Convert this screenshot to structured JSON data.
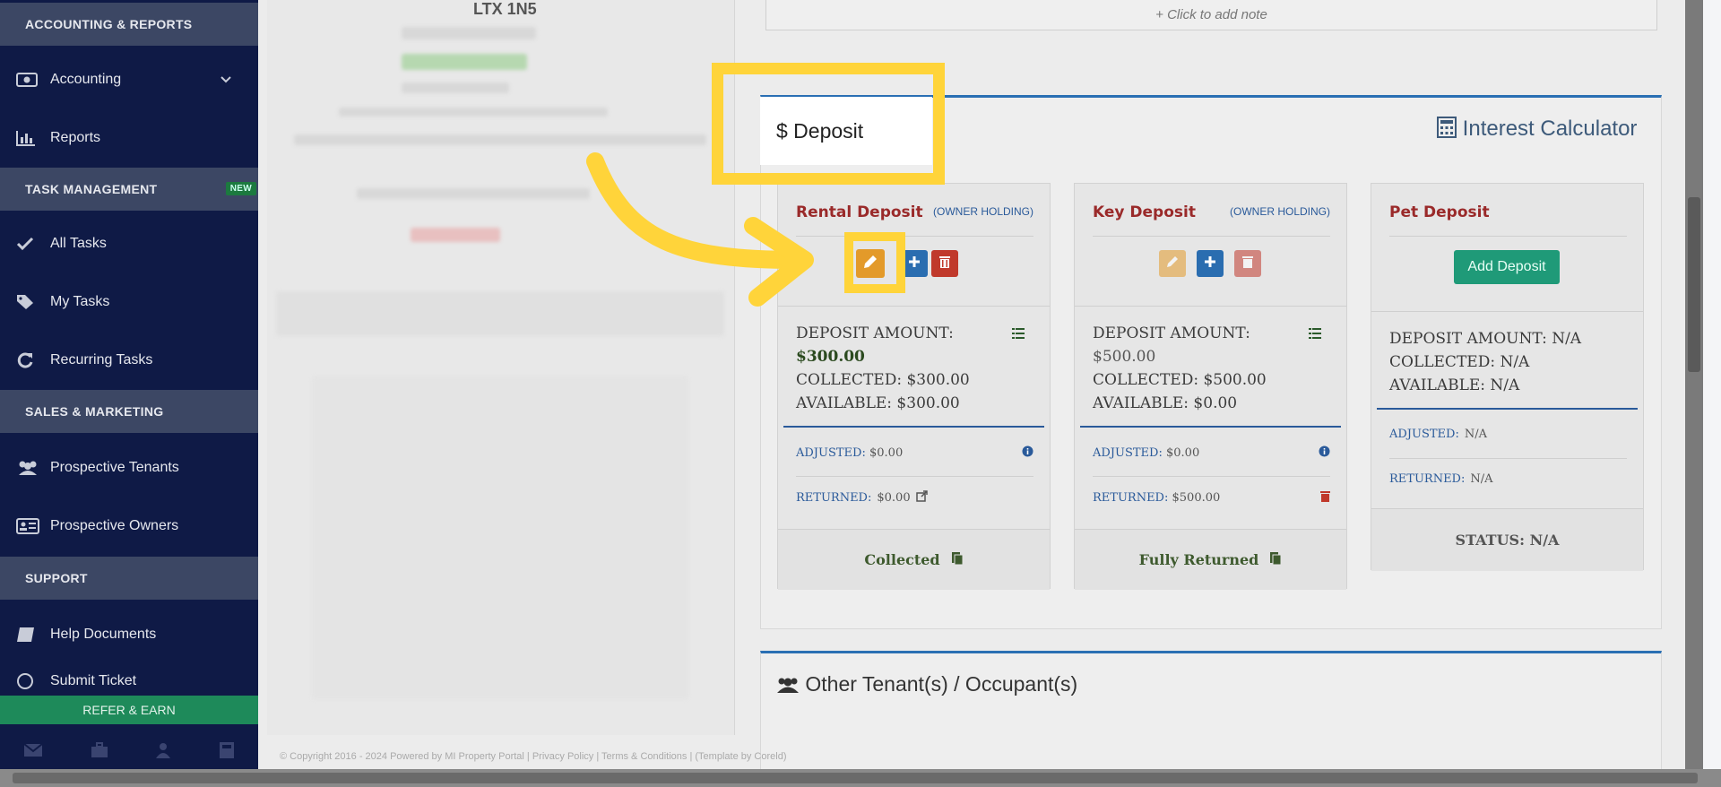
{
  "sidebar": {
    "sections": {
      "accounting": "ACCOUNTING & REPORTS",
      "task": "TASK MANAGEMENT",
      "task_badge": "NEW",
      "sales": "SALES & MARKETING",
      "support": "SUPPORT"
    },
    "items": {
      "accounting": "Accounting",
      "reports": "Reports",
      "all_tasks": "All Tasks",
      "my_tasks": "My Tasks",
      "recurring": "Recurring Tasks",
      "prospective_tenants": "Prospective Tenants",
      "prospective_owners": "Prospective Owners",
      "help_docs": "Help Documents",
      "submit_ticket": "Submit Ticket"
    },
    "refer": "REFER & EARN"
  },
  "main": {
    "ltx_title": "LTX 1N5",
    "note": "+ Click to add note",
    "deposit_title": "$ Deposit",
    "interest_calc": "Interest Calculator",
    "other_tenants": "Other Tenant(s) / Occupant(s)",
    "copyright": "© Copyright 2016 - 2024 Powered by MI Property Portal | Privacy Policy | Terms & Conditions | (Template by Coreld)"
  },
  "cards": [
    {
      "name": "Rental Deposit",
      "owner": "(OWNER HOLDING)",
      "amount_label": "DEPOSIT AMOUNT:",
      "amount": "$300.00",
      "collected": "COLLECTED: $300.00",
      "available": "AVAILABLE: $300.00",
      "adjusted_label": "ADJUSTED:",
      "adjusted": "$0.00",
      "returned_label": "RETURNED:",
      "returned": "$0.00",
      "status": "Collected"
    },
    {
      "name": "Key Deposit",
      "owner": "(OWNER HOLDING)",
      "amount_label": "DEPOSIT AMOUNT:",
      "amount": "$500.00",
      "collected": "COLLECTED: $500.00",
      "available": "AVAILABLE: $0.00",
      "adjusted_label": "ADJUSTED:",
      "adjusted": "$0.00",
      "returned_label": "RETURNED:",
      "returned": "$500.00",
      "status": "Fully Returned"
    },
    {
      "name": "Pet Deposit",
      "add_button": "Add Deposit",
      "amount": "DEPOSIT AMOUNT: N/A",
      "collected": "COLLECTED: N/A",
      "available": "AVAILABLE: N/A",
      "adjusted_label": "ADJUSTED:",
      "adjusted": "N/A",
      "returned_label": "RETURNED:",
      "returned": "N/A",
      "status": "STATUS: N/A"
    }
  ],
  "colors": {
    "sidebar_bg": "#0f1a46",
    "highlight": "#ffd43a",
    "edit": "#e39a2a",
    "add": "#2a6db0",
    "delete": "#c0392b",
    "add_deposit": "#1f9a78"
  }
}
